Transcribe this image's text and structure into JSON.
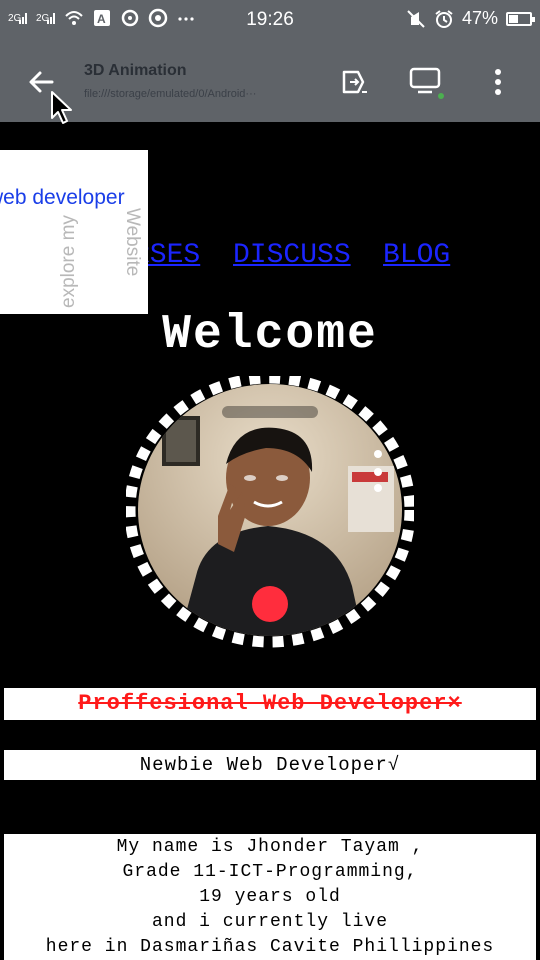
{
  "status_bar": {
    "time": "19:26",
    "battery_percent": "47%",
    "battery_level": 0.47,
    "left_icons": [
      "signal-icon",
      "signal-icon",
      "wifi-icon",
      "notification-a-icon",
      "notification-chat-icon",
      "chrome-icon",
      "more-dots-icon"
    ],
    "right_icons": [
      "mute-icon",
      "alarm-icon",
      "battery-icon"
    ]
  },
  "browser": {
    "title": "3D Animation",
    "url": "file:///storage/emulated/0/Android···",
    "buttons": [
      "back-icon",
      "external-open-icon",
      "cast-icon",
      "menu-icon"
    ]
  },
  "page": {
    "popup": {
      "label": "web developer",
      "vertical_text_1": "Website",
      "vertical_text_2": "explore my"
    },
    "nav": [
      "RSES",
      "DISCUSS",
      "BLOG"
    ],
    "welcome": "Welcome",
    "struck_title": "Proffesional Web Developer×",
    "newbie_title": "Newbie Web Developer√",
    "bio_lines": [
      "My name is Jhonder Tayam ,",
      "Grade 11-ICT-Programming,",
      "19 years old",
      "and i currently live",
      "here in Dasmariñas Cavite Phillippines"
    ]
  },
  "colors": {
    "chrome_gray": "#5f6368",
    "link_blue": "#1b25ff",
    "strike_red": "#ff1a1a"
  }
}
